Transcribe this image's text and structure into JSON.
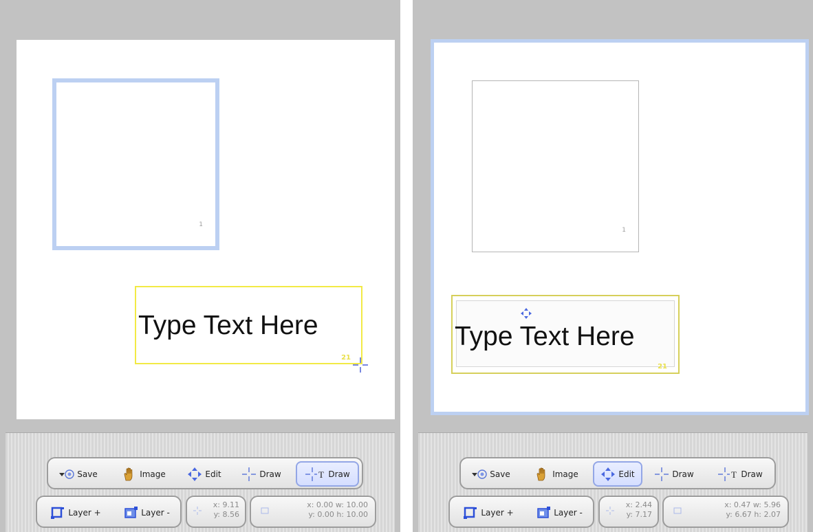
{
  "panels": [
    {
      "id": "left",
      "image_layer_number": "1",
      "text_box": {
        "text": "Type Text Here",
        "layer_number": "21"
      },
      "toolbar": {
        "save": "Save",
        "image": "Image",
        "edit": "Edit",
        "draw": "Draw",
        "text_draw": "Draw",
        "active_tool": "text_draw",
        "layer_plus": "Layer +",
        "layer_minus": "Layer -",
        "pos_x": "x: 9.11",
        "pos_y": "y: 8.56",
        "rect_line1": "x: 0.00 w: 10.00",
        "rect_line2": "y: 0.00 h: 10.00"
      }
    },
    {
      "id": "right",
      "image_layer_number": "1",
      "text_box": {
        "text": "Type Text Here",
        "layer_number": "21"
      },
      "toolbar": {
        "save": "Save",
        "image": "Image",
        "edit": "Edit",
        "draw": "Draw",
        "text_draw": "Draw",
        "active_tool": "edit",
        "layer_plus": "Layer +",
        "layer_minus": "Layer -",
        "pos_x": "x: 2.44",
        "pos_y": "y: 7.17",
        "rect_line1": "x: 0.47 w: 5.96",
        "rect_line2": "y: 6.67 h: 2.07"
      }
    }
  ],
  "colors": {
    "selection_blue": "#bcd0f2",
    "text_box_yellow": "#f2ea45",
    "active_button": "#93a6e6",
    "background_gray": "#c2c2c2"
  },
  "icons": [
    "save-icon",
    "hand-image-icon",
    "move-arrows-icon",
    "crosshair-icon",
    "crosshair-text-icon",
    "layer-add-icon",
    "layer-remove-icon",
    "position-icon",
    "rect-icon"
  ]
}
